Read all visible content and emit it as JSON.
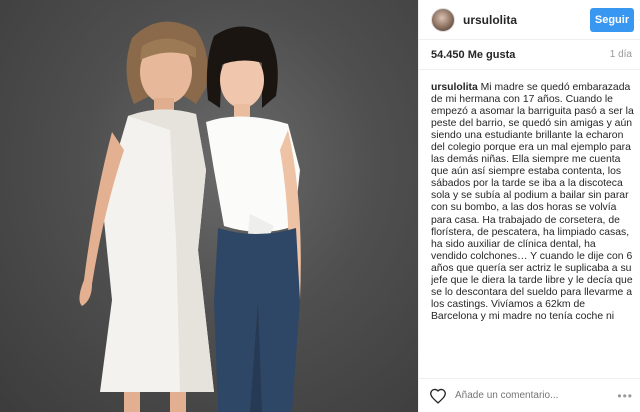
{
  "header": {
    "username": "ursulolita",
    "follow_label": "Seguir"
  },
  "stats": {
    "likes": "54.450 Me gusta",
    "time": "1 día"
  },
  "caption": {
    "author": "ursulolita",
    "text": "Mi madre se quedó embarazada de mi hermana con 17 años. Cuando le empezó a asomar la barriguita pasó a ser la peste del barrio, se quedó sin amigas y aún siendo una estudiante brillante la echaron del colegio porque era un mal ejemplo para las demás niñas. Ella siempre me cuenta que aún así siempre estaba contenta, los sábados por la tarde se iba a la discoteca sola y se subía al podium a bailar sin parar con su bombo, a las dos horas se volvía para casa. Ha trabajado de corsetera, de florístera, de pescatera, ha limpiado casas, ha sido auxiliar de clínica dental, ha vendido colchones… Y cuando le dije con 6 años que quería ser actriz le suplicaba a su jefe que le diera la tarde libre y le decía que se lo descontara del sueldo para llevarme a los castings. Vivíamos a 62km de Barcelona y mi madre no tenía coche ni"
  },
  "comment_bar": {
    "placeholder": "Añade un comentario...",
    "more": "•••"
  },
  "icons": {
    "heart": "heart-icon",
    "more": "more-options-icon"
  },
  "colors": {
    "follow_button": "#3897f0",
    "backdrop": "#4f4f4f"
  }
}
